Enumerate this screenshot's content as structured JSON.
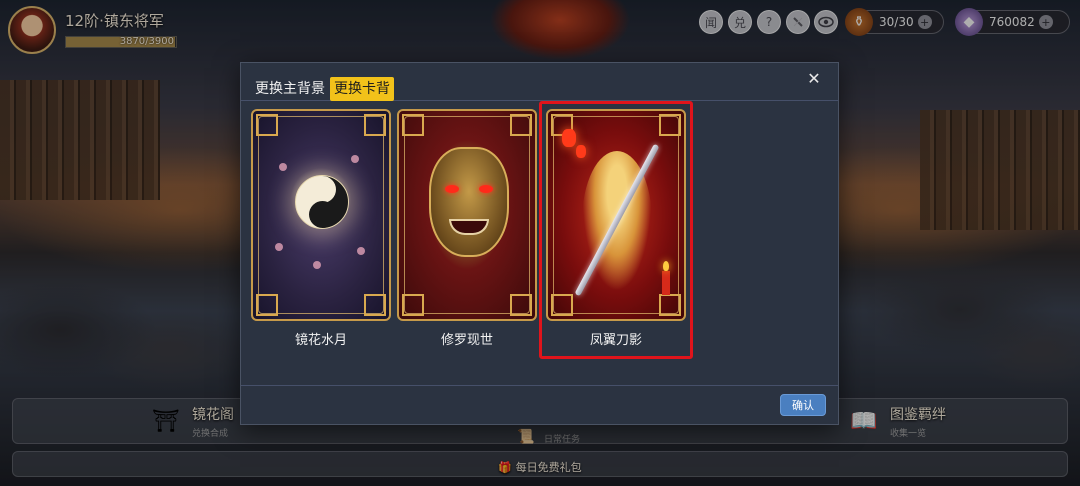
{
  "player": {
    "rank_title": "12阶·镇东将军",
    "xp_text": "3870/3900",
    "xp_progress": 0.99
  },
  "top_icons": [
    {
      "label": "闻",
      "icon": "news-icon"
    },
    {
      "label": "兑",
      "icon": "redeem-icon"
    },
    {
      "label": "?",
      "icon": "help-icon"
    },
    {
      "label": "",
      "icon": "mute-icon"
    },
    {
      "label": "",
      "icon": "eye-icon"
    }
  ],
  "resources": {
    "stamina": {
      "value": "30/30",
      "icon": "stamina-pouch-icon"
    },
    "currency": {
      "value": "760082",
      "icon": "gem-icon"
    }
  },
  "modal": {
    "tabs": [
      {
        "label": "更换主背景",
        "active": false
      },
      {
        "label": "更换卡背",
        "active": true
      }
    ],
    "close_label": "✕",
    "cards": [
      {
        "name": "镜花水月",
        "selected": false
      },
      {
        "name": "修罗现世",
        "selected": false
      },
      {
        "name": "凤翼刀影",
        "selected": true
      }
    ],
    "confirm_label": "确认"
  },
  "bottom": {
    "left_feature": {
      "title": "镜花阁",
      "subtitle": "兑换合成"
    },
    "middle_feature": {
      "subtitle": "日常任务"
    },
    "right_feature": {
      "title": "图鉴羁绊",
      "subtitle": "收集一览"
    },
    "gift_label": "每日免费礼包"
  },
  "colors": {
    "accent_tab": "#f2c21a",
    "selection_border": "#e0141b",
    "confirm_button": "#4a7fc0"
  }
}
